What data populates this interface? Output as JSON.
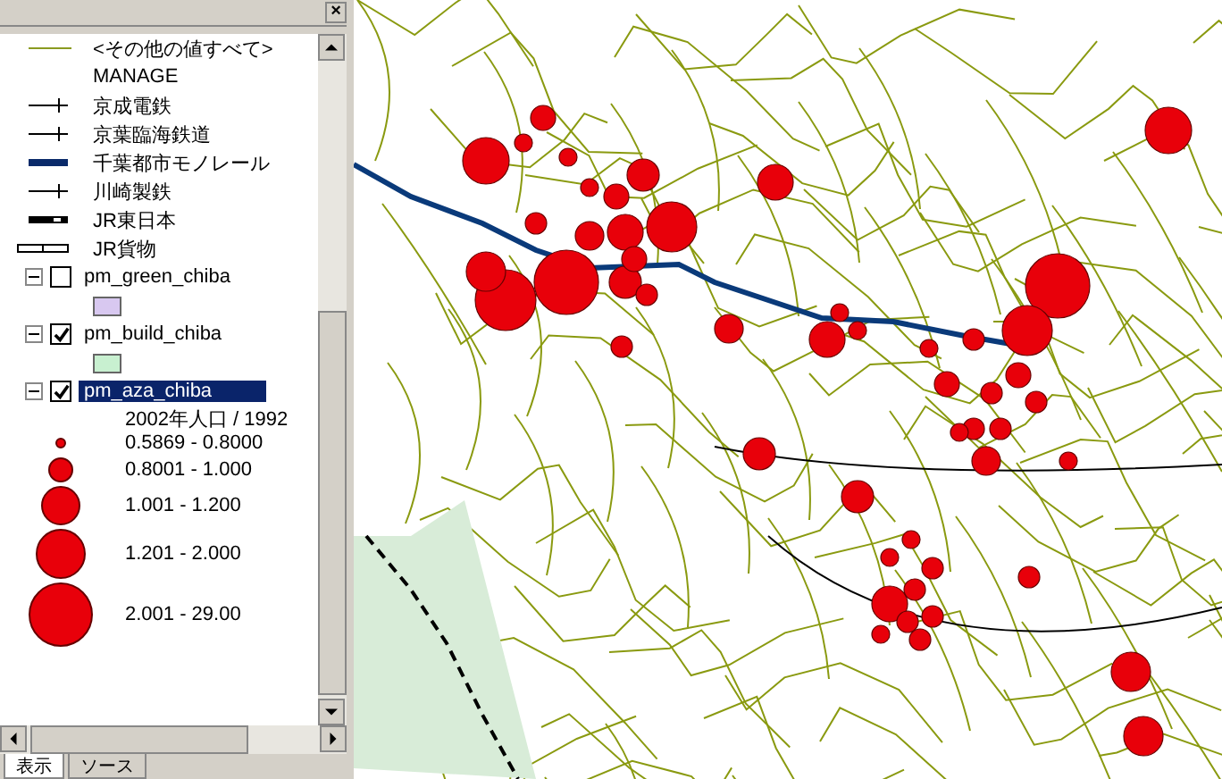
{
  "panel": {
    "close": "×",
    "legend_items": [
      {
        "kind": "thin",
        "label": "<その他の値すべて>"
      },
      {
        "kind": "none",
        "label": "MANAGE"
      },
      {
        "kind": "tick",
        "label": "京成電鉄"
      },
      {
        "kind": "tick",
        "label": "京葉臨海鉄道"
      },
      {
        "kind": "thick",
        "label": "千葉都市モノレール"
      },
      {
        "kind": "tick",
        "label": "川崎製鉄"
      },
      {
        "kind": "jr",
        "label": "JR東日本"
      },
      {
        "kind": "hollow",
        "label": "JR貨物"
      }
    ],
    "layers": [
      {
        "name": "pm_green_chiba",
        "expanded": true,
        "checked": false,
        "selected": false,
        "color": "#d8c8f0"
      },
      {
        "name": "pm_build_chiba",
        "expanded": true,
        "checked": true,
        "selected": false,
        "color": "#c8f0d0"
      },
      {
        "name": "pm_aza_chiba",
        "expanded": true,
        "checked": true,
        "selected": true
      }
    ],
    "field_label": "2002年人口 / 1992",
    "classes": [
      {
        "label": "0.5869 - 0.8000"
      },
      {
        "label": "0.8001 - 1.000"
      },
      {
        "label": "1.001 - 1.200"
      },
      {
        "label": "1.201 - 2.000"
      },
      {
        "label": "2.001 - 29.00"
      }
    ],
    "tabs": [
      {
        "label": "表示",
        "selected": true
      },
      {
        "label": "ソース",
        "selected": false
      }
    ]
  }
}
